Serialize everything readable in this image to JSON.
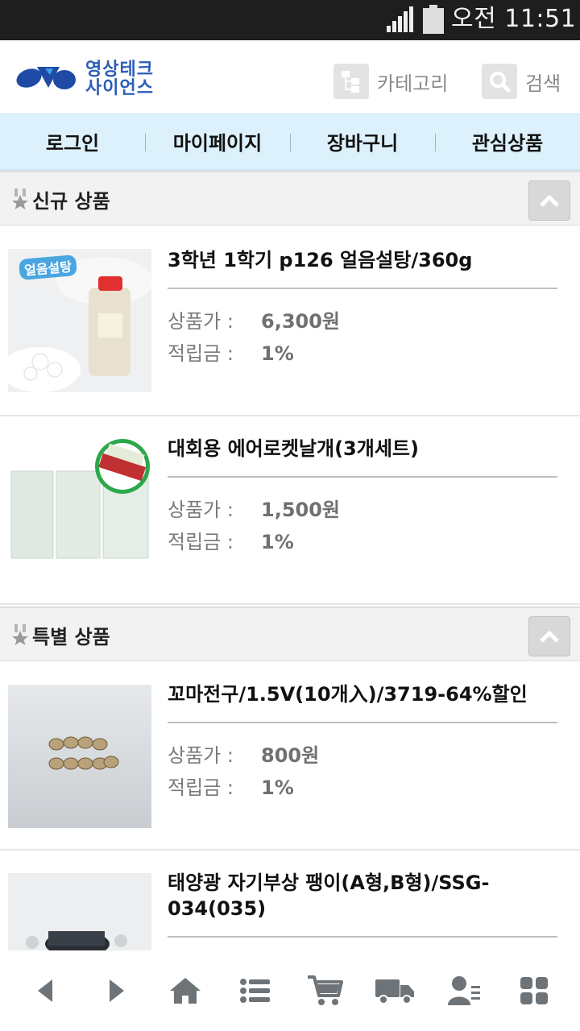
{
  "status_bar": {
    "time": "오전 11:51"
  },
  "header": {
    "logo_text_line1": "영상테크",
    "logo_text_line2": "사이언스",
    "category_label": "카테고리",
    "search_label": "검색"
  },
  "nav": {
    "items": [
      {
        "label": "로그인"
      },
      {
        "label": "마이페이지"
      },
      {
        "label": "장바구니"
      },
      {
        "label": "관심상품"
      }
    ]
  },
  "sections": {
    "new": {
      "title": "신규 상품",
      "products": [
        {
          "name": "3학년 1학기 p126 얼음설탕/360g",
          "price_label": "상품가 :",
          "price": "6,300원",
          "points_label": "적립금 :",
          "points": "1%",
          "thumb_caption": "얼음설탕"
        },
        {
          "name": "대회용 에어로켓날개(3개세트)",
          "price_label": "상품가 :",
          "price": "1,500원",
          "points_label": "적립금 :",
          "points": "1%"
        }
      ]
    },
    "special": {
      "title": "특별 상품",
      "products": [
        {
          "name": "꼬마전구/1.5V(10개入)/3719-64%할인",
          "price_label": "상품가 :",
          "price": "800원",
          "points_label": "적립금 :",
          "points": "1%"
        },
        {
          "name": "태양광 자기부상 팽이(A형,B형)/SSG-034(035)"
        }
      ]
    }
  },
  "bottom_bar": {
    "icons": [
      "back-icon",
      "forward-icon",
      "home-icon",
      "list-icon",
      "cart-icon",
      "delivery-truck-icon",
      "user-profile-icon",
      "grid-menu-icon"
    ]
  },
  "colors": {
    "nav_bg": "#dcf1fb",
    "logo_blue": "#2c5db8",
    "icon_gray": "#7d7d7d"
  }
}
